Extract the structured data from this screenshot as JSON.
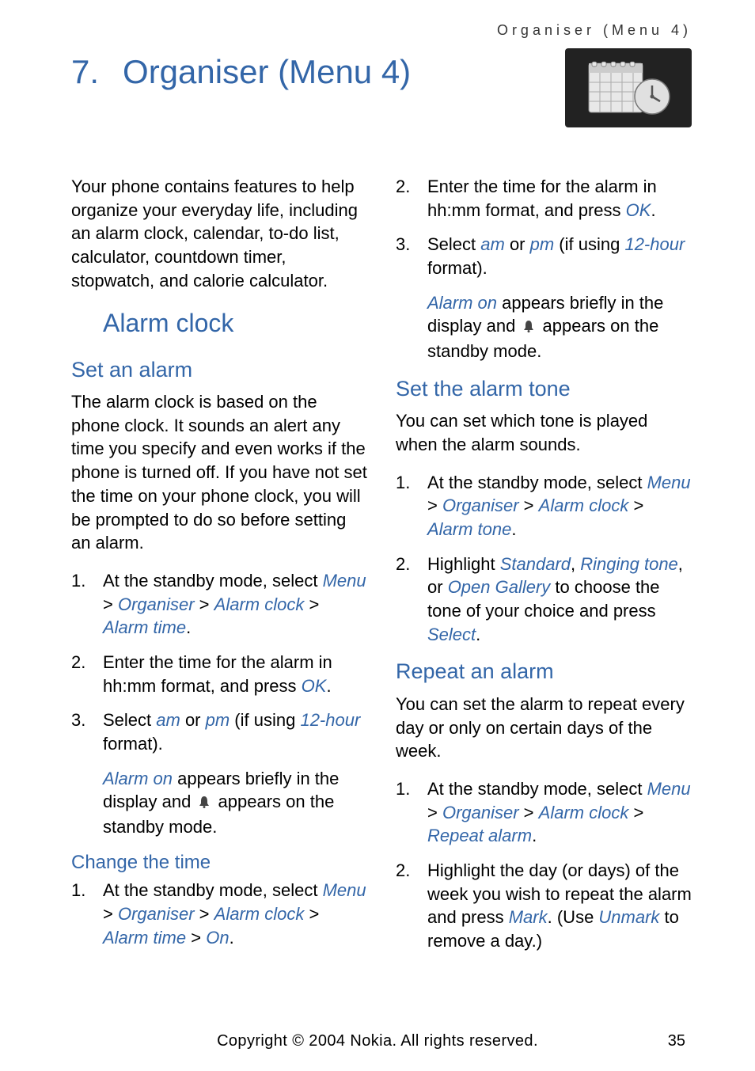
{
  "header": {
    "running": "Organiser (Menu 4)"
  },
  "title": {
    "num": "7.",
    "text": "Organiser (Menu 4)"
  },
  "intro": "Your phone contains features to help organize your everyday life, including an alarm clock, calendar, to-do list, calculator, countdown timer, stopwatch, and calorie calculator.",
  "alarm_clock": {
    "heading": "Alarm clock",
    "set_alarm": {
      "heading": "Set an alarm",
      "intro": "The alarm clock is based on the phone clock. It sounds an alert any time you specify and even works if the phone is turned off. If you have not set the time on your phone clock, you will be prompted to do so before setting an alarm.",
      "steps": {
        "s1": {
          "num": "1.",
          "t1": "At the standby mode, select ",
          "menu": "Menu",
          "gt1": " > ",
          "org": "Organiser",
          "gt2": " > ",
          "ac": "Alarm clock",
          "gt3": " > ",
          "at": "Alarm time",
          "dot": "."
        },
        "s2": {
          "num": "2.",
          "t1": "Enter the time for the alarm in hh:mm format, and press ",
          "ok": "OK",
          "dot": "."
        },
        "s3": {
          "num": "3.",
          "t1": "Select ",
          "am": "am",
          "t2": " or ",
          "pm": "pm",
          "t3": " (if using ",
          "hr12": "12-hour",
          "t4": " format)."
        }
      },
      "note": {
        "ao": "Alarm on",
        "t1": " appears briefly in the display and ",
        "t2": " appears on the standby mode."
      }
    },
    "change_time": {
      "heading": "Change the time",
      "s1": {
        "num": "1.",
        "t1": "At the standby mode, select ",
        "menu": "Menu",
        "gt1": " > ",
        "org": "Organiser",
        "gt2": " > ",
        "ac": "Alarm clock",
        "gt3": " > ",
        "at": "Alarm time",
        "gt4": " > ",
        "on": "On",
        "dot": "."
      },
      "s2": {
        "num": "2.",
        "t1": "Enter the time for the alarm in hh:mm format, and press ",
        "ok": "OK",
        "dot": "."
      },
      "s3": {
        "num": "3.",
        "t1": "Select ",
        "am": "am",
        "t2": " or ",
        "pm": "pm",
        "t3": " (if using ",
        "hr12": "12-hour",
        "t4": " format)."
      },
      "note": {
        "ao": "Alarm on",
        "t1": " appears briefly in the display and ",
        "t2": " appears on the standby mode."
      }
    },
    "set_tone": {
      "heading": "Set the alarm tone",
      "intro": "You can set which tone is played when the alarm sounds.",
      "s1": {
        "num": "1.",
        "t1": "At the standby mode, select ",
        "menu": "Menu",
        "gt1": " > ",
        "org": "Organiser",
        "gt2": " > ",
        "ac": "Alarm clock",
        "gt3": " > ",
        "at": "Alarm tone",
        "dot": "."
      },
      "s2": {
        "num": "2.",
        "t1": "Highlight ",
        "std": "Standard",
        "c1": ", ",
        "rt": "Ringing tone",
        "c2": ", or ",
        "og": "Open Gallery",
        "t2": " to choose the tone of your choice and press ",
        "sel": "Select",
        "dot": "."
      }
    },
    "repeat": {
      "heading": "Repeat an alarm",
      "intro": "You can set the alarm to repeat every day or only on certain days of the week.",
      "s1": {
        "num": "1.",
        "t1": "At the standby mode, select ",
        "menu": "Menu",
        "gt1": " > ",
        "org": "Organiser",
        "gt2": " > ",
        "ac": "Alarm clock",
        "gt3": " > ",
        "ra": "Repeat alarm",
        "dot": "."
      },
      "s2": {
        "num": "2.",
        "t1": "Highlight the day (or days) of the week you wish to repeat the alarm and press ",
        "mark": "Mark",
        "t2": ". (Use ",
        "unmark": "Unmark",
        "t3": " to remove a day.)"
      }
    }
  },
  "footer": {
    "copy": "Copyright © 2004 Nokia. All rights reserved.",
    "page": "35"
  }
}
